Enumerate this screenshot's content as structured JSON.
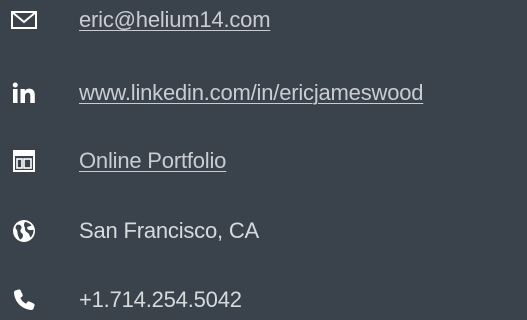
{
  "contacts": {
    "email": {
      "icon": "envelope-icon",
      "label": "eric@helium14.com"
    },
    "linkedin": {
      "icon": "linkedin-icon",
      "label": "www.linkedin.com/in/ericjameswood"
    },
    "portfolio": {
      "icon": "portfolio-icon",
      "label": "Online Portfolio"
    },
    "location": {
      "icon": "globe-icon",
      "label": "San Francisco, CA"
    },
    "phone": {
      "icon": "phone-icon",
      "label": "+1.714.254.5042"
    }
  },
  "colors": {
    "background": "#3a434c",
    "text": "#d6dadd",
    "icon": "#ffffff"
  }
}
